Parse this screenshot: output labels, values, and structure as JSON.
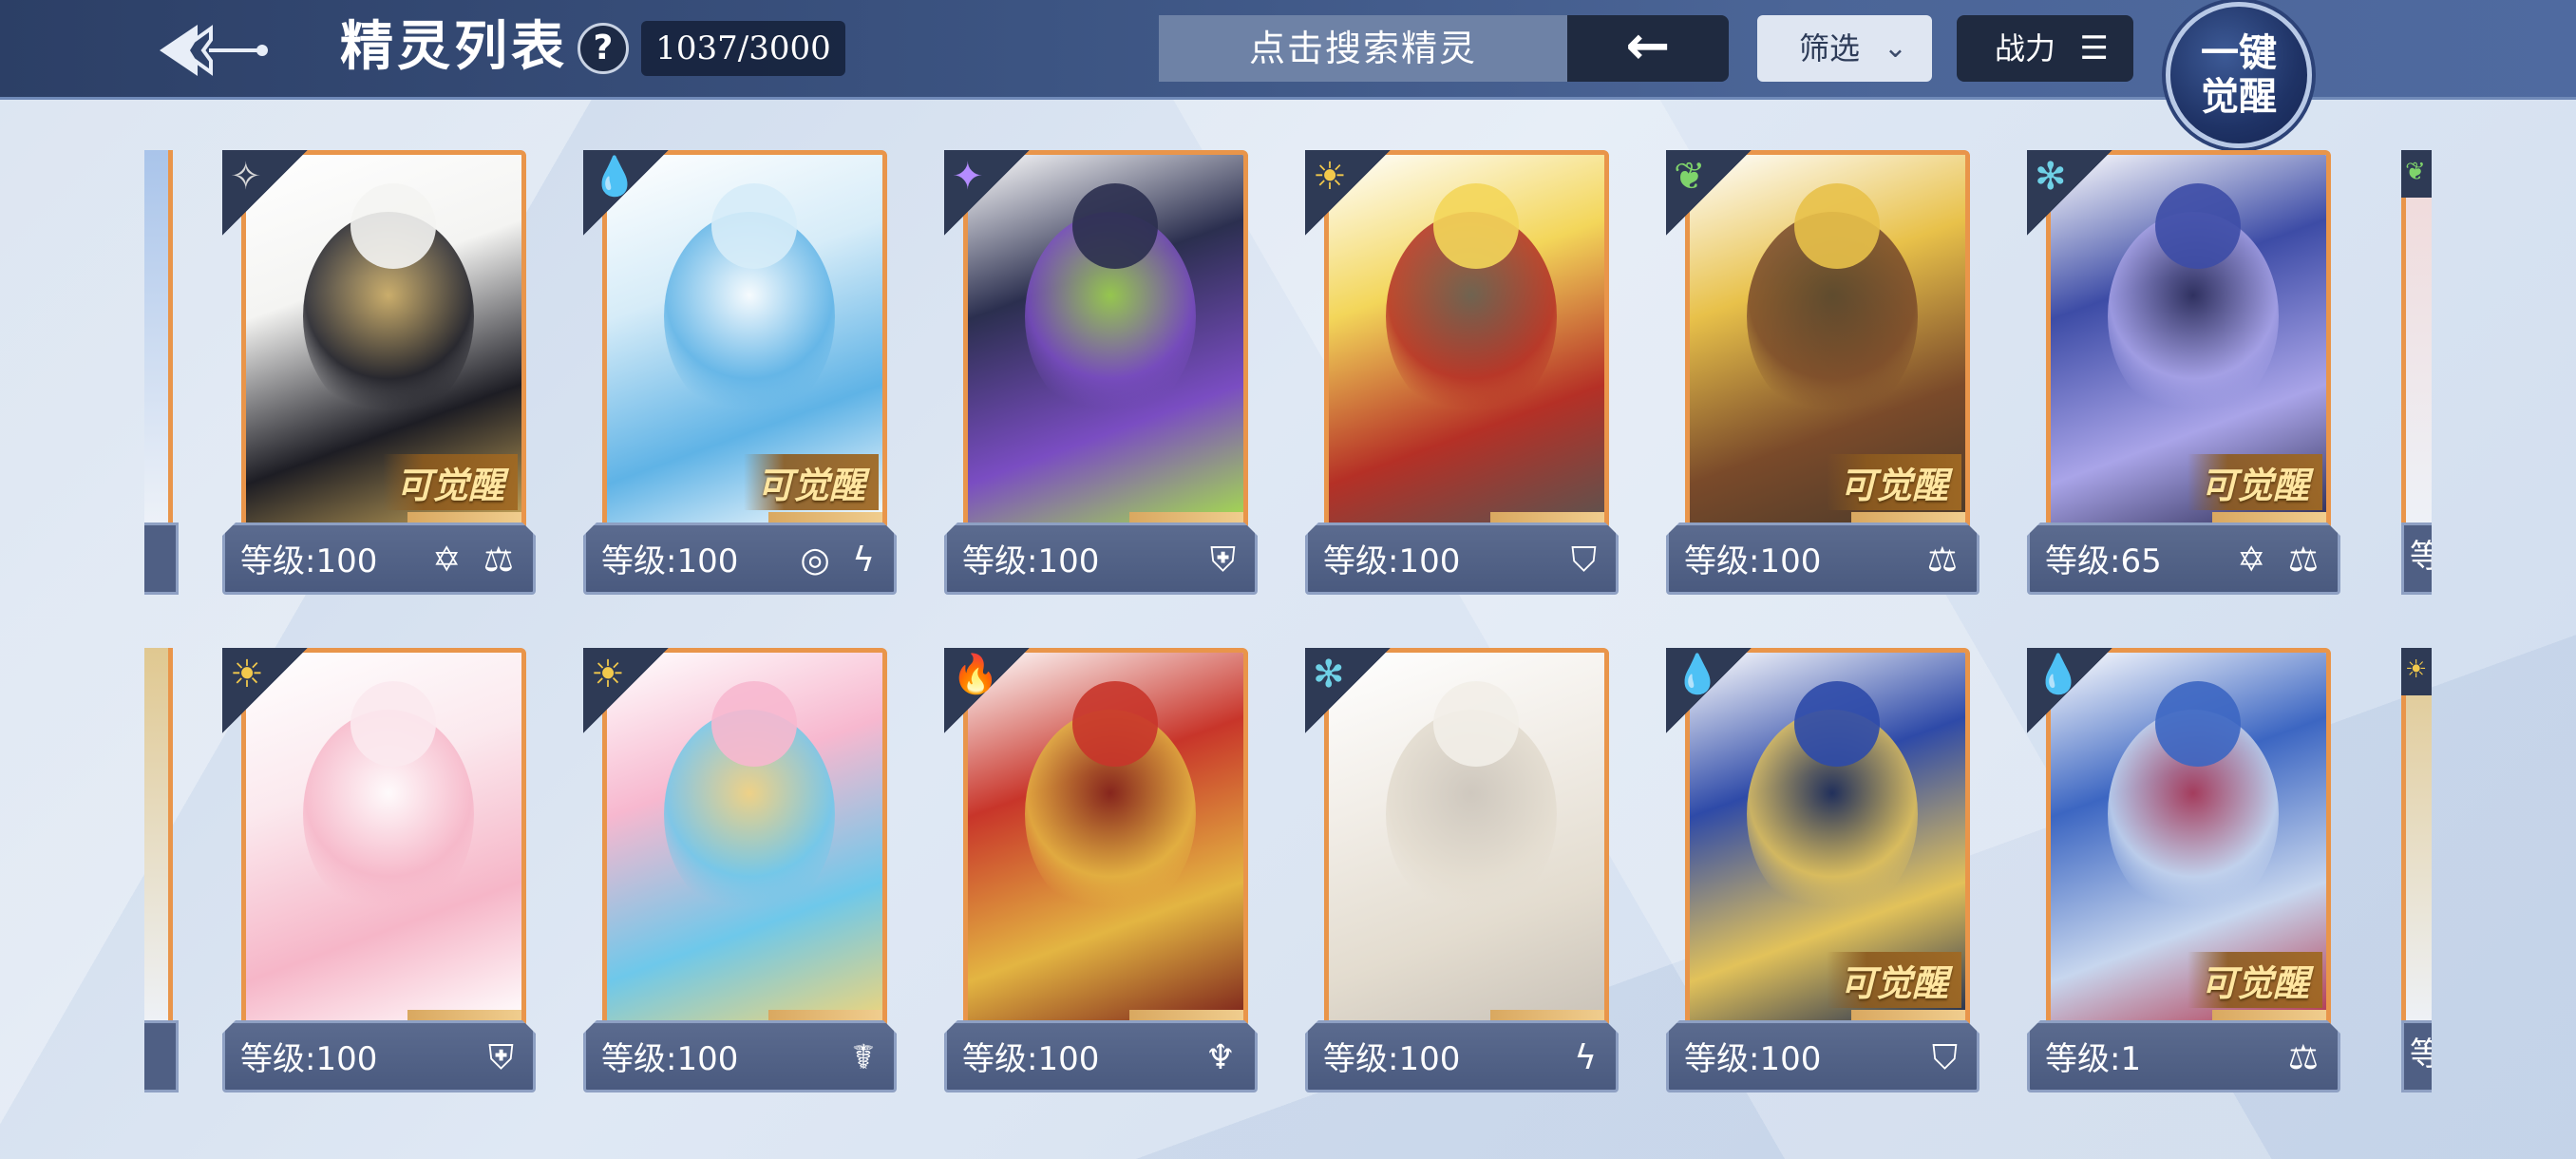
{
  "header": {
    "title": "精灵列表",
    "help_label": "?",
    "count": "1037/3000",
    "search_placeholder": "点击搜索精灵",
    "search_back_icon": "←",
    "filter_label": "筛选",
    "filter_icon": "chevron-double-down-icon",
    "power_label": "战力",
    "sort_icon": "sort-descending-icon",
    "awaken_all_label_1": "一键",
    "awaken_all_label_2": "觉醒"
  },
  "awaken_tag": "可觉醒",
  "level_prefix": "等级:",
  "edge_level_prefix": "等",
  "cards_row1": [
    {
      "element": "mechanical",
      "element_glyph": "✧",
      "level": "100",
      "awakenable": true,
      "type_icons": "✡ ⚖",
      "palette": [
        "#f4f4f2",
        "#1d1d24",
        "#c9a75a"
      ]
    },
    {
      "element": "water",
      "element_glyph": "💧",
      "level": "100",
      "awakenable": true,
      "type_icons": "◎ ϟ",
      "palette": [
        "#d6ecf8",
        "#5fb3e6",
        "#ffffff"
      ]
    },
    {
      "element": "shadow",
      "element_glyph": "✦",
      "level": "100",
      "awakenable": false,
      "type_icons": "⛨",
      "palette": [
        "#2b2f4f",
        "#7a4dc2",
        "#a6e04a"
      ]
    },
    {
      "element": "light",
      "element_glyph": "☀",
      "level": "100",
      "awakenable": false,
      "type_icons": "⛉",
      "palette": [
        "#f3d65a",
        "#b53026",
        "#5a5450"
      ]
    },
    {
      "element": "grass",
      "element_glyph": "❦",
      "level": "100",
      "awakenable": true,
      "type_icons": "⚖",
      "palette": [
        "#e8c14a",
        "#7a4a2a",
        "#4a3a2a"
      ]
    },
    {
      "element": "ice",
      "element_glyph": "✻",
      "level": "65",
      "awakenable": true,
      "type_icons": "✡ ⚖",
      "palette": [
        "#3d4ca6",
        "#a9a4e8",
        "#2a2a52"
      ]
    }
  ],
  "cards_row2": [
    {
      "element": "light",
      "element_glyph": "☀",
      "level": "100",
      "awakenable": false,
      "type_icons": "⛨",
      "palette": [
        "#fbe9ee",
        "#f6b6c8",
        "#ffffff"
      ]
    },
    {
      "element": "light",
      "element_glyph": "☀",
      "level": "100",
      "awakenable": false,
      "type_icons": "☤",
      "palette": [
        "#f7b8cf",
        "#6ec8ea",
        "#f0d57a"
      ]
    },
    {
      "element": "fire",
      "element_glyph": "🔥",
      "level": "100",
      "awakenable": false,
      "type_icons": "♆",
      "palette": [
        "#c8352a",
        "#e3b542",
        "#7a1f1a"
      ]
    },
    {
      "element": "ice",
      "element_glyph": "✻",
      "level": "100",
      "awakenable": false,
      "type_icons": "ϟ",
      "palette": [
        "#f2eee8",
        "#e3dccf",
        "#c9c2b8"
      ]
    },
    {
      "element": "water",
      "element_glyph": "💧",
      "level": "100",
      "awakenable": true,
      "type_icons": "⛉",
      "palette": [
        "#2e4aa8",
        "#e2c25a",
        "#1a2850"
      ]
    },
    {
      "element": "water",
      "element_glyph": "💧",
      "level": "1",
      "awakenable": true,
      "type_icons": "⚖",
      "palette": [
        "#3c66c2",
        "#c7d6ee",
        "#b2324a"
      ]
    }
  ]
}
